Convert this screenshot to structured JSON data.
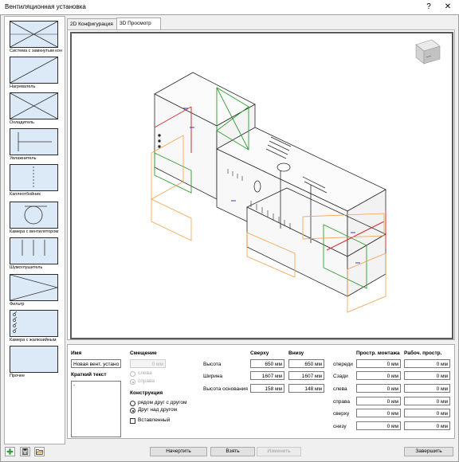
{
  "window": {
    "title": "Вентиляционная установка",
    "help": "?",
    "close": "✕"
  },
  "palette": [
    {
      "label": "Система с замкнутым конт",
      "icon": "closed-loop-icon"
    },
    {
      "label": "Нагреватель",
      "icon": "heater-icon"
    },
    {
      "label": "Охладитель",
      "icon": "cooler-icon"
    },
    {
      "label": "Увлажнитель",
      "icon": "humidifier-icon"
    },
    {
      "label": "Каплеотбойник",
      "icon": "droplet-eliminator-icon"
    },
    {
      "label": "Камера с вентилятором",
      "icon": "fan-chamber-icon"
    },
    {
      "label": "Шумоглушитель",
      "icon": "silencer-icon"
    },
    {
      "label": "Фильтр",
      "icon": "filter-icon"
    },
    {
      "label": "Камера с жалюзийным",
      "icon": "louver-chamber-icon"
    },
    {
      "label": "Прочее",
      "icon": "other-icon"
    }
  ],
  "tabs": [
    {
      "label": "2D Конфигурация"
    },
    {
      "label": "3D Просмотр"
    }
  ],
  "form": {
    "name_label": "Имя",
    "name_value": "Новая вент. устано",
    "short_text_label": "Краткий текст",
    "short_text_value": "-",
    "offset_label": "Смещение",
    "offset_value": "0 мм",
    "offset_left": "слева",
    "offset_right": "справа",
    "construction_label": "Конструкция",
    "construction_side": "рядом друг с другом",
    "construction_stack": "Друг над другом",
    "inserted_label": "Вставленный",
    "col_top": "Сверху",
    "col_bottom": "Внизу",
    "dims": [
      {
        "label": "Высота",
        "top": "650 мм",
        "bottom": "650 мм"
      },
      {
        "label": "Ширина",
        "top": "1607 мм",
        "bottom": "1607 мм"
      },
      {
        "label": "Высота основания",
        "top": "158 мм",
        "bottom": "148 мм"
      }
    ],
    "col_mount": "Простр. монтажа",
    "col_work": "Рабоч. простр.",
    "spaces": [
      {
        "label": "спереди",
        "mount": "0 мм",
        "work": "0 мм"
      },
      {
        "label": "Сзади",
        "mount": "0 мм",
        "work": "0 мм"
      },
      {
        "label": "слева",
        "mount": "0 мм",
        "work": "0 мм"
      },
      {
        "label": "справа",
        "mount": "0 мм",
        "work": "0 мм"
      },
      {
        "label": "сверху",
        "mount": "0 мм",
        "work": "0 мм"
      },
      {
        "label": "снизу",
        "mount": "0 мм",
        "work": "0 мм"
      }
    ]
  },
  "footer": {
    "start": "Начертить",
    "take": "Взять",
    "change": "Изменить",
    "finish": "Завершить"
  },
  "colors": {
    "accent_green": "#2e9e2e",
    "highlight_orange": "#f5a04a",
    "highlight_red": "#d83030",
    "thumb_fill": "#dce9f7"
  }
}
